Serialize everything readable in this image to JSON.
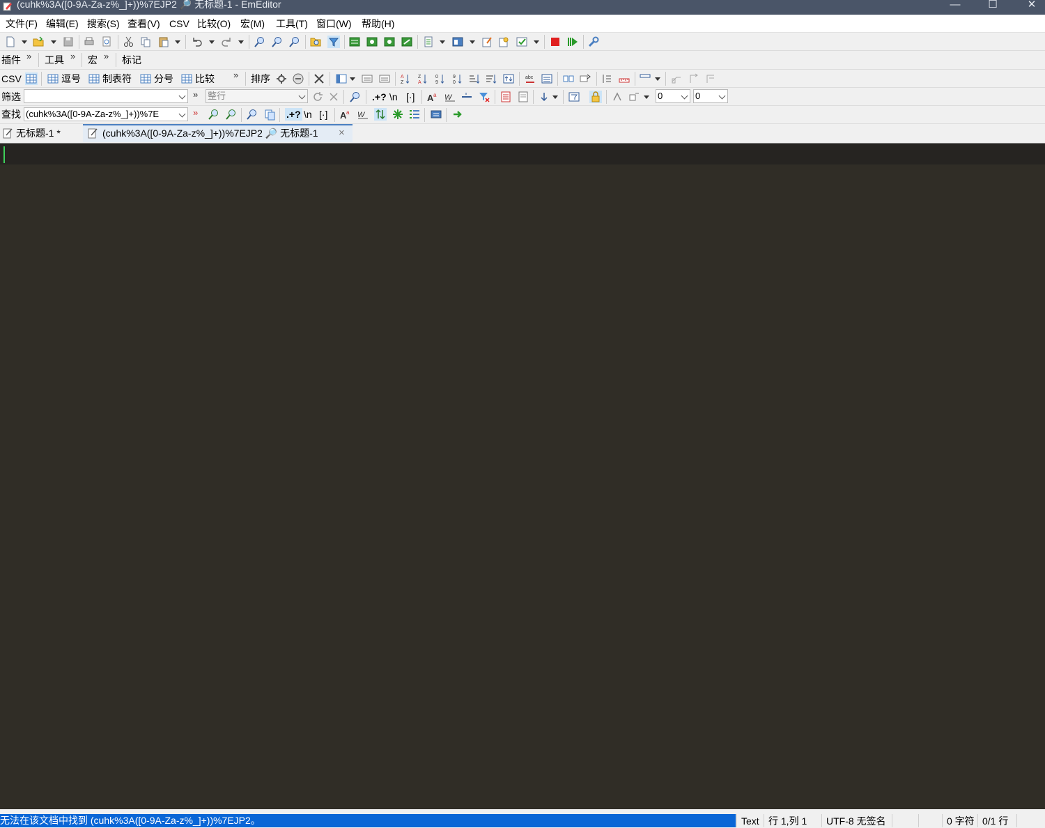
{
  "window": {
    "title": "(cuhk%3A([0-9A-Za-z%_]+))%7EJP2 🔎 无标题-1 - EmEditor",
    "minimize": "—",
    "maximize": "☐",
    "close": "✕"
  },
  "menu": [
    "文件(F)",
    "编辑(E)",
    "搜索(S)",
    "查看(V)",
    "CSV",
    "比较(O)",
    "宏(M)",
    "工具(T)",
    "窗口(W)",
    "帮助(H)"
  ],
  "toolbar2": {
    "plugins": "插件",
    "tools": "工具",
    "macros": "宏",
    "marks": "标记",
    "more": "»"
  },
  "csv_toolbar": {
    "csv": "CSV",
    "comma": "逗号",
    "tab": "制表符",
    "semicolon": "分号",
    "compare": "比较",
    "more": "»",
    "sort": "排序"
  },
  "filter_toolbar": {
    "label": "筛选",
    "filter_value": "",
    "more": "»",
    "scope": "整行",
    "num1": "0",
    "num2": "0",
    "regex": ".+?",
    "newline": "\\n",
    "brackets": "[·]"
  },
  "find_toolbar": {
    "label": "查找",
    "query": "(cuhk%3A([0-9A-Za-z%_]+))%7E",
    "more": "»",
    "regex": ".+?",
    "newline": "\\n",
    "brackets": "[·]"
  },
  "tabs": [
    {
      "label": "无标题-1 *"
    },
    {
      "label": "(cuhk%3A([0-9A-Za-z%_]+))%7EJP2 🔎 无标题-1",
      "close": "×"
    }
  ],
  "status": {
    "message": "无法在该文档中找到 (cuhk%3A([0-9A-Za-z%_]+))%7EJP2。",
    "mode": "Text",
    "position": "行 1,列 1",
    "encoding": "UTF-8 无签名",
    "chars": "0 字符",
    "lines": "0/1 行"
  },
  "colors": {
    "titlebar": "#4a5568",
    "editor_bg": "#302d26",
    "caret": "#3fd15a",
    "status_msg_bg": "#0a66d6"
  }
}
